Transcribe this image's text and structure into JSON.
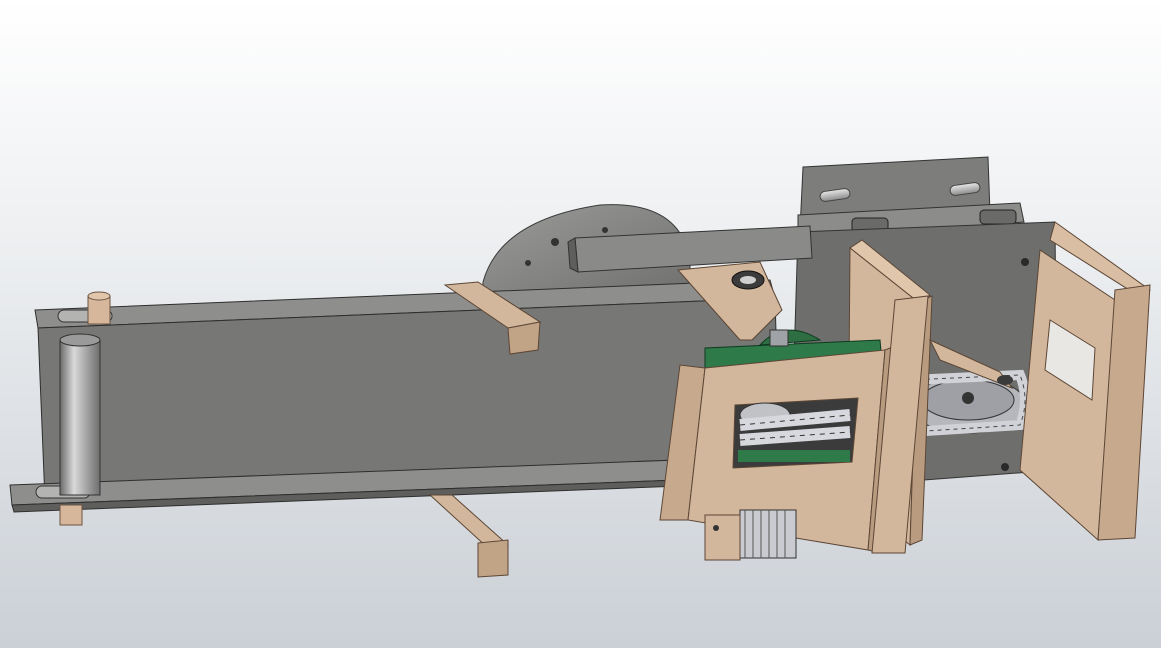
{
  "scene": {
    "view": "cad-3d-model-viewport",
    "subject": "chain-driven-conveyor-assembly",
    "colors": {
      "background_top": "#ffffff",
      "background_bottom": "#cbd0d6",
      "steel_gray": "#7a7a78",
      "steel_dark": "#5c5c5a",
      "wood_tan": "#d3b79c",
      "wood_tan_dark": "#a98d73",
      "motor_green": "#2e7a48",
      "chain_silver": "#c4c6cc"
    }
  }
}
